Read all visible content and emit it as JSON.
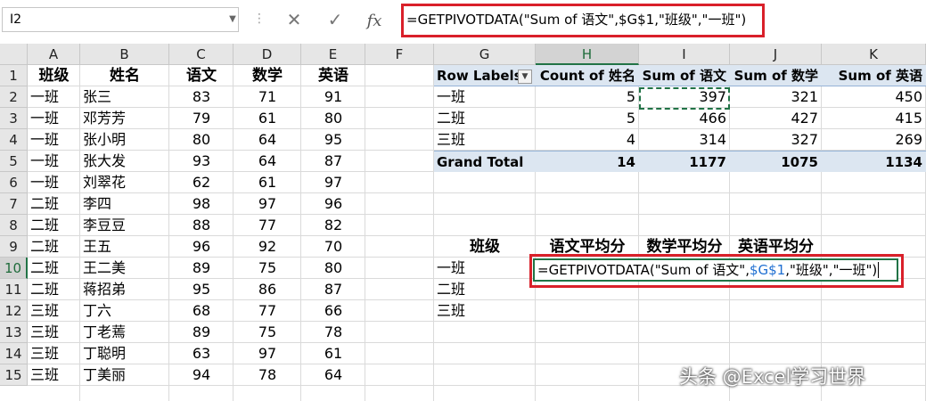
{
  "formula_bar": {
    "name_box": "I2",
    "cancel_icon": "✕",
    "enter_icon": "✓",
    "fx_label": "fx",
    "formula": "=GETPIVOTDATA(\"Sum of 语文\",$G$1,\"班级\",\"一班\")"
  },
  "columns": [
    "A",
    "B",
    "C",
    "D",
    "E",
    "F",
    "G",
    "H",
    "I",
    "J",
    "K"
  ],
  "rows": [
    "1",
    "2",
    "3",
    "4",
    "5",
    "6",
    "7",
    "8",
    "9",
    "10",
    "11",
    "12",
    "13",
    "14",
    "15"
  ],
  "source_table": {
    "headers": [
      "班级",
      "姓名",
      "语文",
      "数学",
      "英语"
    ],
    "rows": [
      [
        "一班",
        "张三",
        "83",
        "71",
        "91"
      ],
      [
        "一班",
        "邓芳芳",
        "79",
        "61",
        "80"
      ],
      [
        "一班",
        "张小明",
        "80",
        "64",
        "95"
      ],
      [
        "一班",
        "张大发",
        "93",
        "64",
        "87"
      ],
      [
        "一班",
        "刘翠花",
        "62",
        "61",
        "97"
      ],
      [
        "二班",
        "李四",
        "98",
        "97",
        "96"
      ],
      [
        "二班",
        "李豆豆",
        "88",
        "77",
        "82"
      ],
      [
        "二班",
        "王五",
        "96",
        "92",
        "70"
      ],
      [
        "二班",
        "王二美",
        "89",
        "75",
        "80"
      ],
      [
        "二班",
        "蒋招弟",
        "95",
        "86",
        "87"
      ],
      [
        "三班",
        "丁六",
        "68",
        "77",
        "66"
      ],
      [
        "三班",
        "丁老蔫",
        "89",
        "75",
        "78"
      ],
      [
        "三班",
        "丁聪明",
        "63",
        "97",
        "61"
      ],
      [
        "三班",
        "丁美丽",
        "94",
        "78",
        "64"
      ]
    ]
  },
  "pivot": {
    "headers": [
      "Row Labels",
      "Count of 姓名",
      "Sum of 语文",
      "Sum of 数学",
      "Sum of 英语"
    ],
    "filter_icon": "▼",
    "rows": [
      [
        "一班",
        "5",
        "397",
        "321",
        "450"
      ],
      [
        "二班",
        "5",
        "466",
        "427",
        "415"
      ],
      [
        "三班",
        "4",
        "314",
        "327",
        "269"
      ]
    ],
    "total": [
      "Grand Total",
      "14",
      "1177",
      "1075",
      "1134"
    ]
  },
  "averages": {
    "headers": [
      "班级",
      "语文平均分",
      "数学平均分",
      "英语平均分"
    ],
    "classes": [
      "一班",
      "二班",
      "三班"
    ],
    "edit_parts": [
      "=GETPIVOTDATA(\"Sum of 语文\",",
      "$G$1",
      ",\"班级\",\"一班\")"
    ]
  },
  "watermark": "头条 @Excel学习世界"
}
